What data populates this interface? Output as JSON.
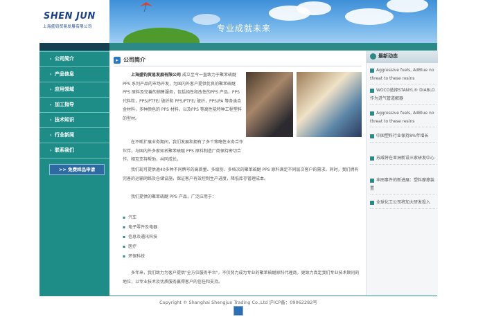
{
  "header": {
    "logo": "SHEN JUN",
    "logo_cn": "上海盛钧贸易发展有限公司",
    "slogan": "专业成就未来"
  },
  "nav": {
    "items": [
      {
        "label": "公司简介"
      },
      {
        "label": "产品信息"
      },
      {
        "label": "应用领域"
      },
      {
        "label": "加工指导"
      },
      {
        "label": "技术知识"
      },
      {
        "label": "行业新闻"
      },
      {
        "label": "联系我们"
      }
    ],
    "sample_button": "免费样品申请"
  },
  "content": {
    "title": "公司简介",
    "intro_company": "上海盛钧贸易发展有限公司",
    "intro_rest": "成立至今一直致力于聚苯硫醚 PPS 系列产品的市场开发，为国内外客户提供优良的聚苯硫醚 PPS 原料及完善的销售服务，包括纯性和改性的PPS 产品，PPS 代料粒，PPS/PTFE/ 玻纤和 PPS/PTFE/ 玻纤，PPS/PA 等各类合金材料，多种颜色的 PPS 材料，以及PPS 等高性能特种工程塑料的型材。",
    "p2": "在不断扩展业务期间，我们发展和拥有了多个策略性业务合作伙伴，与国内外多家知名聚苯硫醚 PPS 原料制造厂商保持密切合作，相互支持帮助，共同成长。",
    "p3": "我们现可提供逾40多种不同牌号的高质量、多级别、多档次的聚苯硫醚 PPS 原料满足不同层次客户的需求。同时，我们拥有完善的运输网络及仓储设施，保证客户有效控制生产进度，降低库存管理成本。",
    "p4": "我们提供的聚苯硫醚 PPS 产品，广泛应用于：",
    "apps": [
      "汽车",
      "电子零件及电器",
      "信息及通讯科技",
      "医疗",
      "环保科技"
    ],
    "p5": "多年来，我们致力为客户提供\"全方位服务平台\"，不仅努力成为专业的聚苯硫醚原料代理商，更致力真定我们专业技术顾问的地位，以专业技术及优质服务赢得客户的信任和支持。"
  },
  "news": {
    "title": "最新动态",
    "items": [
      "Aggressive fuels, AdBlue no threat to these resins",
      "WOCO选择STANYL® DIABLO作为进气管道解器",
      "Aggressive fuels, AdBlue no threat to these resins",
      "中国塑料行业保持8%年增长",
      "苏威将在亚洲新设三家研发中心",
      "丰田事件的新进展：塑料摩擦装置",
      "全球化工公司将加大研发投入"
    ]
  },
  "footer": {
    "text": "Copyright © Shanghai Shengjun Trading Co.,Ltd    沪ICP备：09062282号"
  },
  "colors": {
    "teal": "#1e8c87",
    "dark_strip": "#173f52",
    "brand_blue": "#1a3f8f"
  }
}
